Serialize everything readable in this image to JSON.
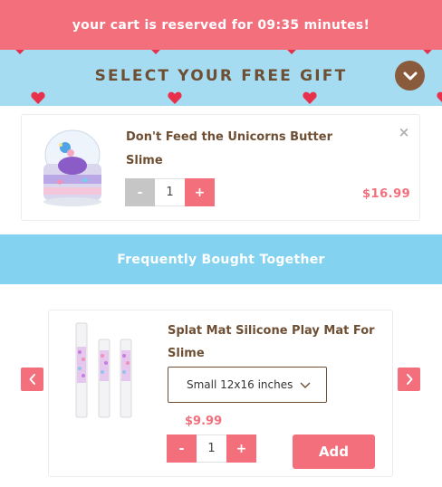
{
  "banner": {
    "text": "your cart is reserved for 09:35 minutes!"
  },
  "gift": {
    "title": "SELECT YOUR FREE GIFT"
  },
  "cart_item": {
    "name": "Don't Feed the Unicorns Butter Slime",
    "quantity": "1",
    "minus": "-",
    "plus": "+",
    "price": "$16.99",
    "close": "×"
  },
  "fbt": {
    "title": "Frequently Bought Together"
  },
  "recommendation": {
    "name": "Splat Mat Silicone Play Mat For Slime",
    "size_selected": "Small 12x16 inches",
    "price": "$9.99",
    "quantity": "1",
    "minus": "-",
    "plus": "+",
    "add_label": "Add"
  },
  "colors": {
    "pink": "#f36f7c",
    "light_blue": "#a6dcf1",
    "sky_blue": "#83d2ef",
    "brown": "#6e4f33",
    "heart_red": "#e8304b"
  }
}
